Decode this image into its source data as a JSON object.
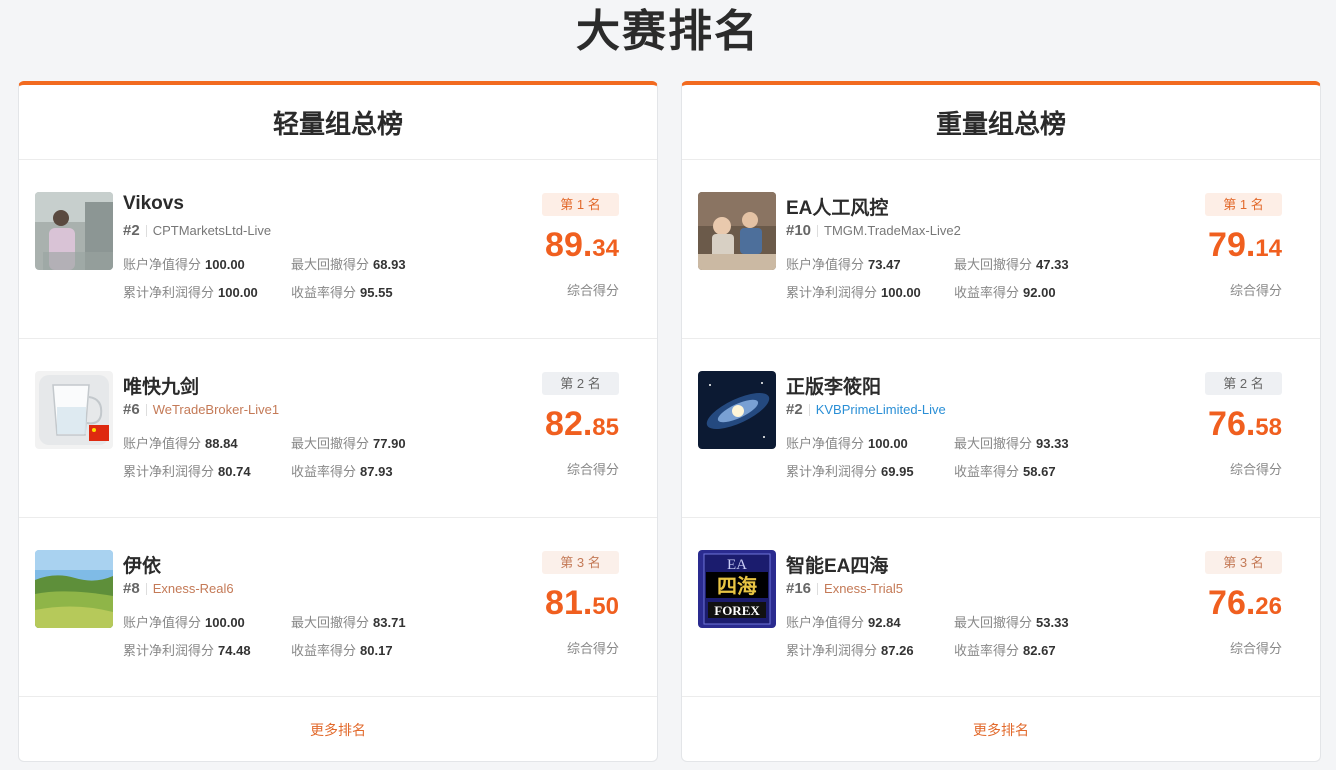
{
  "page_title": "大赛排名",
  "colors": {
    "accent": "#f26a1f",
    "score": "#f05f1f"
  },
  "groups": [
    {
      "title": "轻量组总榜",
      "more_label": "更多排名",
      "entries": [
        {
          "name": "Vikovs",
          "rankno": "#2",
          "broker": "CPTMarketsLtd-Live",
          "badge": "第 1 名",
          "score_int": "89.",
          "score_dec": "34",
          "score_label": "综合得分",
          "m1_label": "账户净值得分",
          "m1_value": "100.00",
          "m2_label": "最大回撤得分",
          "m2_value": "68.93",
          "m3_label": "累计净利润得分",
          "m3_value": "100.00",
          "m4_label": "收益率得分",
          "m4_value": "95.55",
          "avatar_icon": "person-photo"
        },
        {
          "name": "唯快九剑",
          "rankno": "#6",
          "broker": "WeTradeBroker-Live1",
          "badge": "第 2 名",
          "score_int": "82.",
          "score_dec": "85",
          "score_label": "综合得分",
          "m1_label": "账户净值得分",
          "m1_value": "88.84",
          "m2_label": "最大回撤得分",
          "m2_value": "77.90",
          "m3_label": "累计净利润得分",
          "m3_value": "80.74",
          "m4_label": "收益率得分",
          "m4_value": "87.93",
          "avatar_icon": "glass-cup-with-flag"
        },
        {
          "name": "伊依",
          "rankno": "#8",
          "broker": "Exness-Real6",
          "badge": "第 3 名",
          "score_int": "81.",
          "score_dec": "50",
          "score_label": "综合得分",
          "m1_label": "账户净值得分",
          "m1_value": "100.00",
          "m2_label": "最大回撤得分",
          "m2_value": "83.71",
          "m3_label": "累计净利润得分",
          "m3_value": "74.48",
          "m4_label": "收益率得分",
          "m4_value": "80.17",
          "avatar_icon": "landscape-field"
        }
      ]
    },
    {
      "title": "重量组总榜",
      "more_label": "更多排名",
      "entries": [
        {
          "name": "EA人工风控",
          "rankno": "#10",
          "broker": "TMGM.TradeMax-Live2",
          "badge": "第 1 名",
          "score_int": "79.",
          "score_dec": "14",
          "score_label": "综合得分",
          "m1_label": "账户净值得分",
          "m1_value": "73.47",
          "m2_label": "最大回撤得分",
          "m2_value": "47.33",
          "m3_label": "累计净利润得分",
          "m3_value": "100.00",
          "m4_label": "收益率得分",
          "m4_value": "92.00",
          "avatar_icon": "children-photo"
        },
        {
          "name": "正版李筱阳",
          "rankno": "#2",
          "broker": "KVBPrimeLimited-Live",
          "badge": "第 2 名",
          "score_int": "76.",
          "score_dec": "58",
          "score_label": "综合得分",
          "m1_label": "账户净值得分",
          "m1_value": "100.00",
          "m2_label": "最大回撤得分",
          "m2_value": "93.33",
          "m3_label": "累计净利润得分",
          "m3_value": "69.95",
          "m4_label": "收益率得分",
          "m4_value": "58.67",
          "avatar_icon": "galaxy-image"
        },
        {
          "name": "智能EA四海",
          "rankno": "#16",
          "broker": "Exness-Trial5",
          "badge": "第 3 名",
          "score_int": "76.",
          "score_dec": "26",
          "score_label": "综合得分",
          "m1_label": "账户净值得分",
          "m1_value": "92.84",
          "m2_label": "最大回撤得分",
          "m2_value": "53.33",
          "m3_label": "累计净利润得分",
          "m3_value": "87.26",
          "m4_label": "收益率得分",
          "m4_value": "82.67",
          "avatar_icon": "ea-forex-logo",
          "avatar_text": [
            "EA",
            "四海",
            "FOREX"
          ]
        }
      ]
    }
  ]
}
